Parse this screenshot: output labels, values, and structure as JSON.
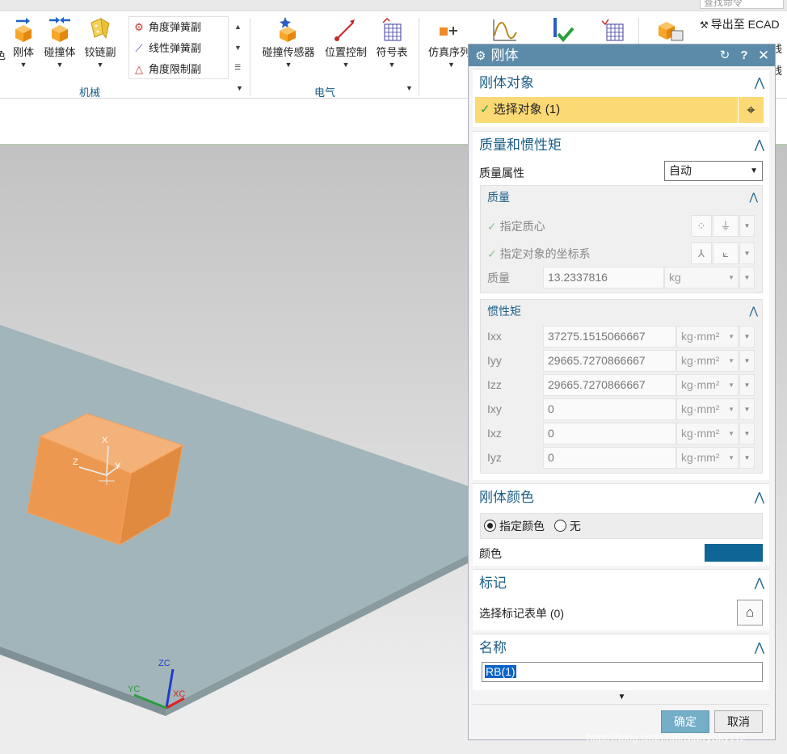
{
  "ribbon": {
    "find_placeholder": "查找命令",
    "btn_partial": "色",
    "btn_rigid": "刚体",
    "btn_collision": "碰撞体",
    "btn_hinge": "铰链副",
    "small_items": [
      "角度弹簧副",
      "线性弹簧副",
      "角度限制副"
    ],
    "group_mech": "机械",
    "btn_collision_sensor": "碰撞传感器",
    "btn_position_control": "位置控制",
    "btn_symbol_table": "符号表",
    "group_elec": "电气",
    "btn_sim_sequence": "仿真序列",
    "export_ecad": "导出至 ECAD",
    "partial_right_1": "线",
    "partial_right_2": "线"
  },
  "dialog": {
    "title": "刚体",
    "sec_object": "刚体对象",
    "select_object": "选择对象 (1)",
    "sec_mass": "质量和惯性矩",
    "mass_prop_label": "质量属性",
    "mass_prop_value": "自动",
    "sub_mass": "质量",
    "spec_cm": "指定质心",
    "spec_csys": "指定对象的坐标系",
    "mass_label": "质量",
    "mass_value": "13.2337816",
    "mass_unit": "kg",
    "sub_inertia": "惯性矩",
    "inertia": [
      {
        "label": "Ixx",
        "value": "37275.1515066667",
        "unit": "kg·mm²"
      },
      {
        "label": "Iyy",
        "value": "29665.7270866667",
        "unit": "kg·mm²"
      },
      {
        "label": "Izz",
        "value": "29665.7270866667",
        "unit": "kg·mm²"
      },
      {
        "label": "Ixy",
        "value": "0",
        "unit": "kg·mm²"
      },
      {
        "label": "Ixz",
        "value": "0",
        "unit": "kg·mm²"
      },
      {
        "label": "Iyz",
        "value": "0",
        "unit": "kg·mm²"
      }
    ],
    "sec_color": "刚体颜色",
    "radio_specify": "指定颜色",
    "radio_none": "无",
    "color_label": "颜色",
    "color_value": "#0f6696",
    "sec_marker": "标记",
    "marker_select": "选择标记表单 (0)",
    "sec_name": "名称",
    "name_value": "RB(1)",
    "ok": "确定",
    "cancel": "取消"
  },
  "viewport": {
    "axis_zc": "ZC",
    "axis_yc": "YC",
    "axis_xc": "XC",
    "cube_x": "X",
    "cube_y": "Y",
    "cube_z": "Z"
  },
  "watermark": "https://blog.csdn.net/StarrySky112",
  "colors": {
    "accent": "#1c5f87",
    "titlebar": "#5b8ba9",
    "select": "#fbd974",
    "body": "#f0a050",
    "plate": "#a2b5ba"
  }
}
